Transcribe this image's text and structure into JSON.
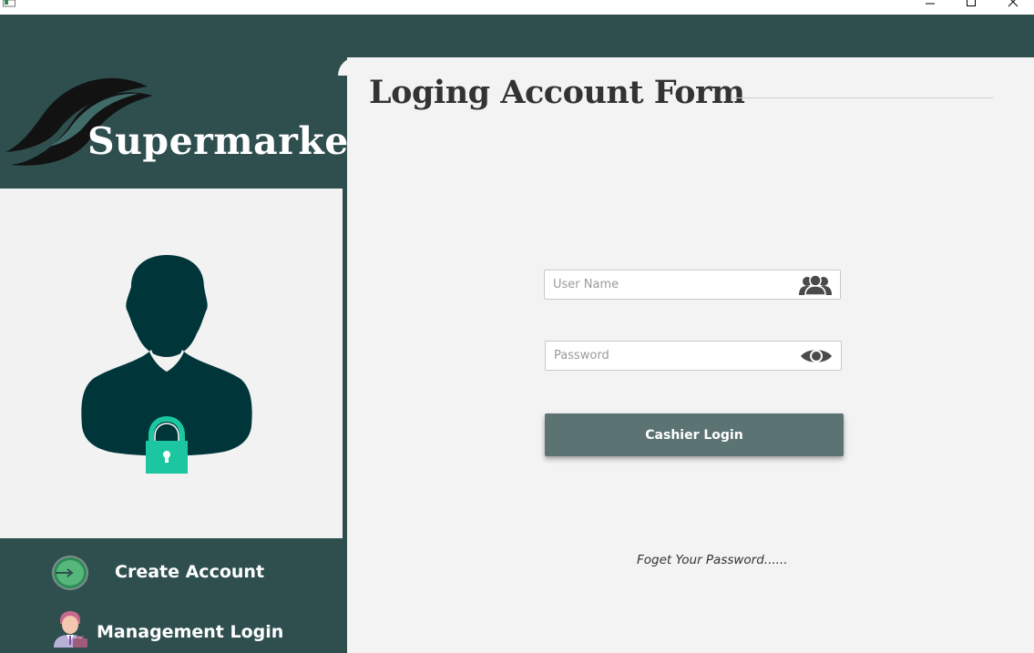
{
  "window": {
    "controls": {
      "minimize_icon": "minimize-icon",
      "maximize_icon": "maximize-icon",
      "close_icon": "close-icon"
    }
  },
  "colors": {
    "brand_dark": "#2f4f4f",
    "panel_bg": "#f3f3f3",
    "button_bg": "#5b7372",
    "avatar": "#00363a",
    "lock": "#1cc6a0"
  },
  "sidebar": {
    "brand": "Supermarket",
    "nav": [
      {
        "label": "Create Account",
        "icon": "arrow-circle-icon"
      },
      {
        "label": "Management Login",
        "icon": "manager-icon"
      }
    ]
  },
  "form": {
    "title": "Loging Account Form",
    "username": {
      "placeholder": "User Name",
      "value": "",
      "icon": "users-icon"
    },
    "password": {
      "placeholder": "Password",
      "value": "",
      "icon": "eye-icon"
    },
    "login_button": "Cashier Login",
    "forgot_link": "Foget Your Password......"
  }
}
